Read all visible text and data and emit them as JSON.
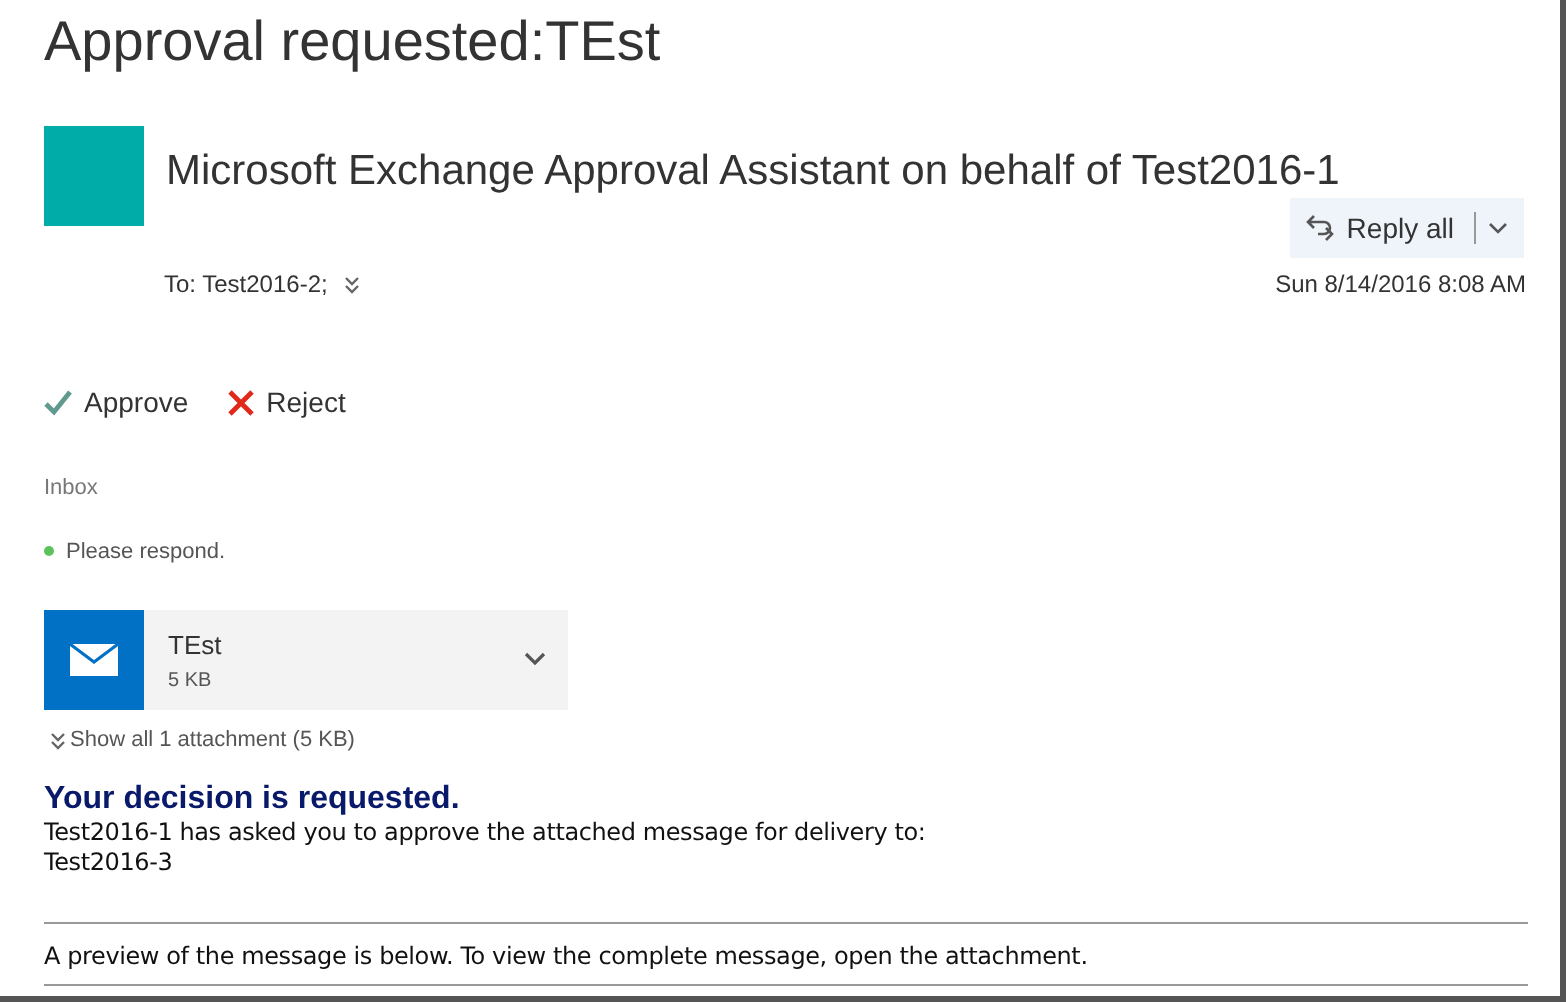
{
  "subject": "Approval requested:TEst",
  "sender": "Microsoft Exchange Approval Assistant on behalf of Test2016-1",
  "reply_button": {
    "label": "Reply all"
  },
  "to": "To: Test2016-2;",
  "date": "Sun 8/14/2016 8:08 AM",
  "actions": [
    {
      "kind": "approve",
      "label": "Approve"
    },
    {
      "kind": "reject",
      "label": "Reject"
    }
  ],
  "folder": "Inbox",
  "flag": "Please respond.",
  "attachment": {
    "name": "TEst",
    "size": "5 KB"
  },
  "show_all": "Show all 1 attachment (5 KB)",
  "body": {
    "heading": "Your decision is requested.",
    "lines": [
      "Test2016-1 has asked you to approve the attached message for delivery to:",
      "Test2016-3"
    ],
    "preview_note": "A preview of the message is below. To view the complete message, open the attachment."
  }
}
